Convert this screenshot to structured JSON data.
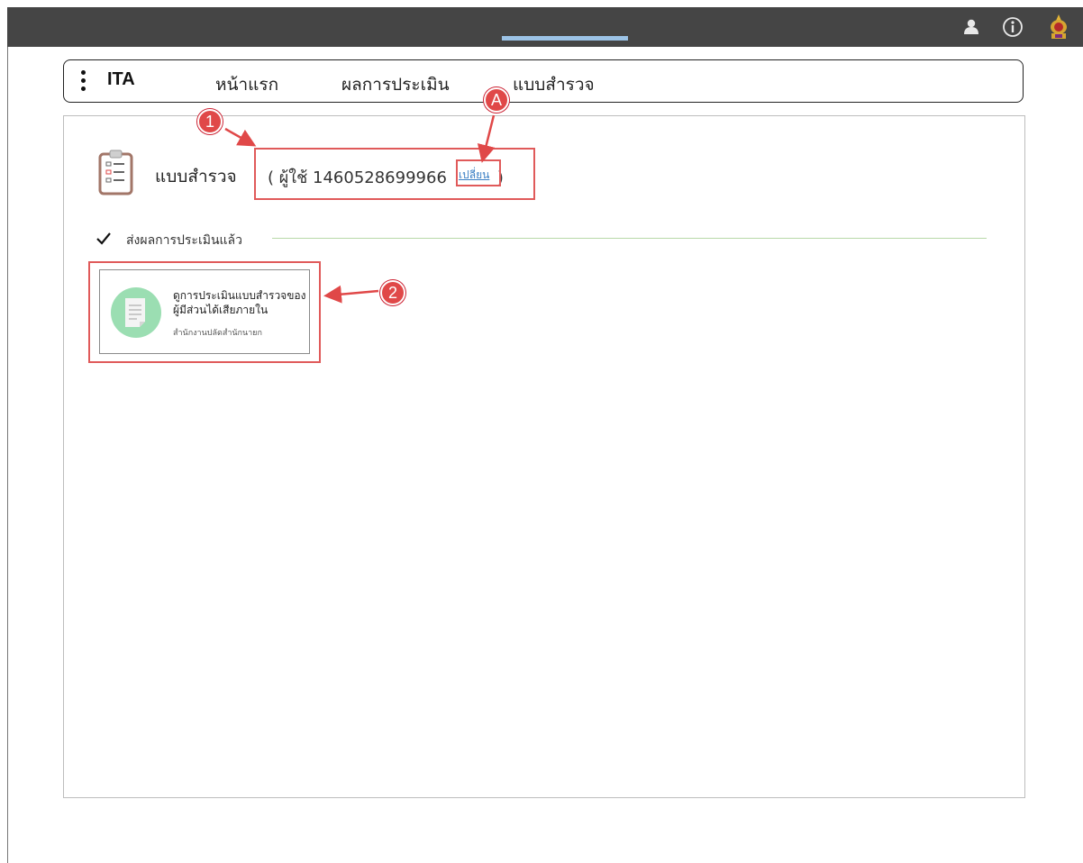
{
  "header": {
    "user_icon": "user-icon",
    "info_icon": "info-icon",
    "logo_icon": "emblem-logo-icon"
  },
  "nav": {
    "brand": "ITA",
    "tabs": [
      "หน้าแรก",
      "ผลการประเมิน",
      "แบบสำรวจ"
    ],
    "active_tab": "แบบสำรวจ"
  },
  "page": {
    "title": "แบบสำรวจ",
    "user_prefix": "( ผู้ใช้ 1460528699966",
    "change_link": "เปลี่ยน",
    "user_suffix": ")",
    "section_label": "ส่งผลการประเมินแล้ว",
    "card": {
      "title": "ดูการประเมินแบบสำรวจของผู้มีส่วนได้เสียภายใน",
      "subtitle": "สำนักงานปลัดสำนักนายก"
    }
  },
  "annotations": {
    "badge_1": "1",
    "badge_2": "2",
    "badge_a": "A",
    "accent_color": "#e04848",
    "active_underline_color": "#9cc3e6",
    "card_icon_color": "#9bdeb2"
  }
}
